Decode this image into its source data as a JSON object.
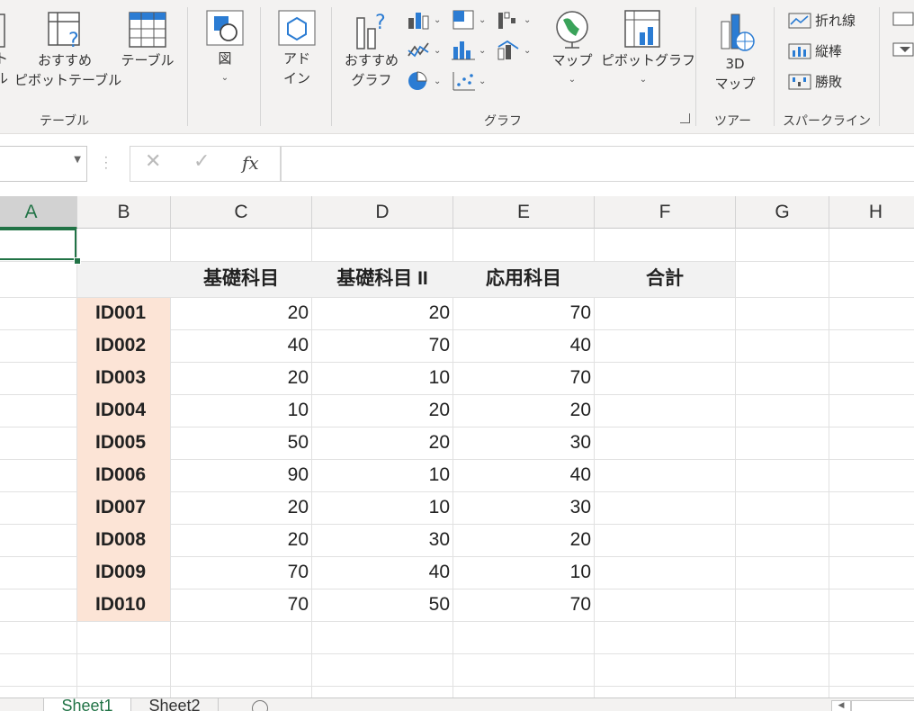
{
  "ribbon": {
    "table_group": {
      "label": "テーブル",
      "pivot_partial_1": "ト",
      "pivot_partial_2": "ル",
      "recommended_pivot_1": "おすすめ",
      "recommended_pivot_2": "ピボットテーブル",
      "table_btn": "テーブル"
    },
    "illustrations": {
      "label": "図"
    },
    "addins": {
      "label_1": "アド",
      "label_2": "イン"
    },
    "charts": {
      "label": "グラフ",
      "recommended_1": "おすすめ",
      "recommended_2": "グラフ",
      "map": "マップ",
      "pivot_chart": "ピボットグラフ"
    },
    "tours": {
      "label": "ツアー",
      "map3d_1": "3D",
      "map3d_2": "マップ"
    },
    "sparklines": {
      "label": "スパークライン",
      "line": "折れ線",
      "column": "縦棒",
      "winloss": "勝敗"
    }
  },
  "formula_bar": {
    "name_box": "",
    "fx": "fx",
    "formula": ""
  },
  "columns": [
    "A",
    "B",
    "C",
    "D",
    "E",
    "F",
    "G",
    "H"
  ],
  "table": {
    "headers": [
      "",
      "基礎科目",
      "基礎科目 II",
      "応用科目",
      "合計"
    ],
    "rows": [
      {
        "id": "ID001",
        "v": [
          "20",
          "20",
          "70",
          ""
        ]
      },
      {
        "id": "ID002",
        "v": [
          "40",
          "70",
          "40",
          ""
        ]
      },
      {
        "id": "ID003",
        "v": [
          "20",
          "10",
          "70",
          ""
        ]
      },
      {
        "id": "ID004",
        "v": [
          "10",
          "20",
          "20",
          ""
        ]
      },
      {
        "id": "ID005",
        "v": [
          "50",
          "20",
          "30",
          ""
        ]
      },
      {
        "id": "ID006",
        "v": [
          "90",
          "10",
          "40",
          ""
        ]
      },
      {
        "id": "ID007",
        "v": [
          "20",
          "10",
          "30",
          ""
        ]
      },
      {
        "id": "ID008",
        "v": [
          "20",
          "30",
          "20",
          ""
        ]
      },
      {
        "id": "ID009",
        "v": [
          "70",
          "40",
          "10",
          ""
        ]
      },
      {
        "id": "ID010",
        "v": [
          "70",
          "50",
          "70",
          ""
        ]
      }
    ]
  },
  "sheets": [
    {
      "name": "Sheet1",
      "active": true
    },
    {
      "name": "Sheet2",
      "active": false
    }
  ],
  "colors": {
    "accent": "#217346",
    "id_fill": "#fce4d6",
    "header_fill": "#f2f2f2",
    "icon_blue": "#2b7cd3"
  }
}
